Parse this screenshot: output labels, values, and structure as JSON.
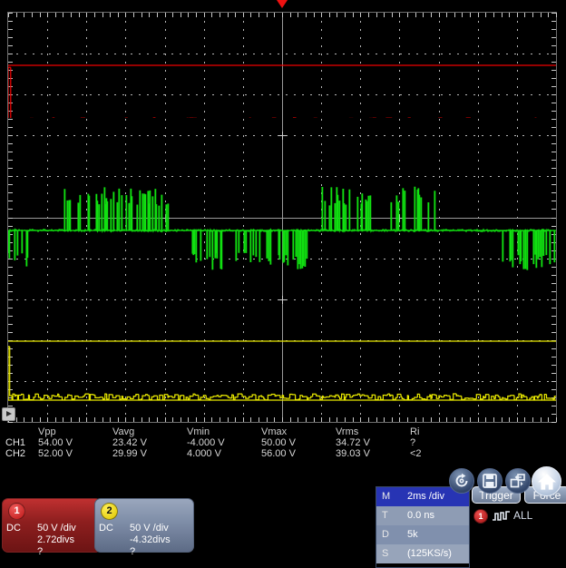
{
  "screen": {
    "trigger_marker_x_pct": 50,
    "run_marker": "run-indicator"
  },
  "measurements": {
    "headers": [
      "",
      "Vpp",
      "Vavg",
      "Vmin",
      "Vmax",
      "Vrms",
      "Ri"
    ],
    "rows": [
      {
        "channel": "CH1",
        "vpp": "54.00 V",
        "vavg": "23.42 V",
        "vmin": "-4.000 V",
        "vmax": "50.00 V",
        "vrms": "34.72 V",
        "ri": "?"
      },
      {
        "channel": "CH2",
        "vpp": "52.00 V",
        "vavg": "29.99 V",
        "vmin": "4.000 V",
        "vmax": "56.00 V",
        "vrms": "39.03 V",
        "ri": "<2"
      }
    ]
  },
  "channels": [
    {
      "badge": "1",
      "coupling": "DC",
      "scale": "50 V /div",
      "offset": "2.72divs",
      "probe": "?",
      "color": "#cc2222"
    },
    {
      "badge": "2",
      "coupling": "DC",
      "scale": "50 V /div",
      "offset": "-4.32divs",
      "probe": "?",
      "color": "#e3d400"
    }
  ],
  "timebase": {
    "rows": [
      {
        "key": "M",
        "value": "2ms /div"
      },
      {
        "key": "T",
        "value": "0.0 ns"
      },
      {
        "key": "D",
        "value": "5k"
      },
      {
        "key": "S",
        "value": "(125KS/s)"
      }
    ]
  },
  "trigger": {
    "trigger_label": "Trigger",
    "force_label": "Force",
    "source_badge": "1",
    "mode_label": "ALL",
    "slope_icon": "trigger-slope-icon"
  },
  "toolbar": {
    "items": [
      {
        "name": "measure-icon",
        "label": ""
      },
      {
        "name": "save-icon",
        "label": ""
      },
      {
        "name": "transfer-icon",
        "label": ""
      },
      {
        "name": "home-icon",
        "label": ""
      }
    ]
  },
  "traces": {
    "ch1": {
      "color": "#ee0000",
      "name": "ch1-trace"
    },
    "ch2": {
      "color": "#11e011",
      "name": "ch2-trace"
    },
    "ch3": {
      "color": "#e8e800",
      "name": "ch3-trace"
    }
  }
}
